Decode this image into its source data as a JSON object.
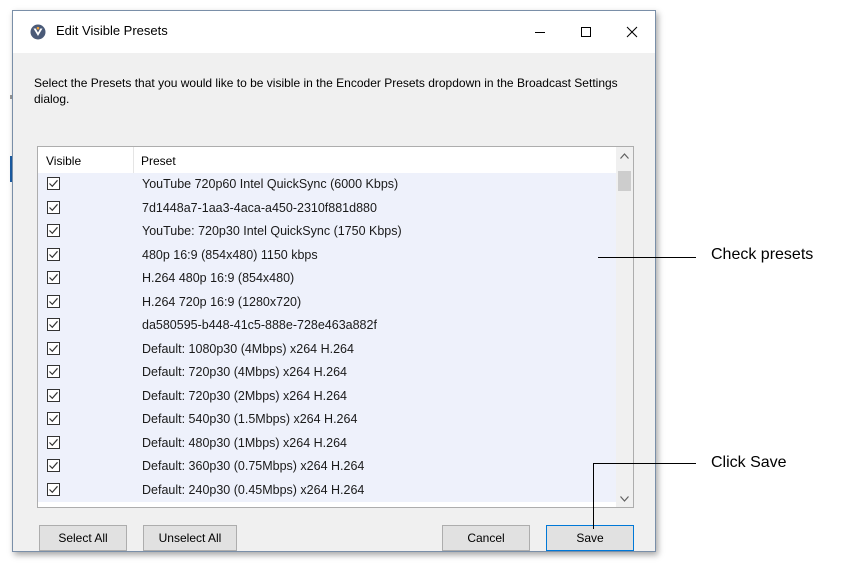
{
  "dialog": {
    "title": "Edit Visible Presets",
    "instructions": "Select the Presets that you would like to be visible in the Encoder Presets dropdown in the Broadcast Settings dialog."
  },
  "list": {
    "columns": {
      "visible": "Visible",
      "preset": "Preset"
    },
    "rows": [
      {
        "checked": true,
        "name": "YouTube 720p60 Intel QuickSync (6000 Kbps)"
      },
      {
        "checked": true,
        "name": "7d1448a7-1aa3-4aca-a450-2310f881d880"
      },
      {
        "checked": true,
        "name": "YouTube: 720p30 Intel QuickSync (1750 Kbps)"
      },
      {
        "checked": true,
        "name": "480p 16:9 (854x480) 1150 kbps"
      },
      {
        "checked": true,
        "name": "H.264 480p 16:9 (854x480)"
      },
      {
        "checked": true,
        "name": "H.264 720p 16:9 (1280x720)"
      },
      {
        "checked": true,
        "name": "da580595-b448-41c5-888e-728e463a882f"
      },
      {
        "checked": true,
        "name": "Default: 1080p30 (4Mbps) x264 H.264"
      },
      {
        "checked": true,
        "name": "Default: 720p30 (4Mbps) x264 H.264"
      },
      {
        "checked": true,
        "name": "Default: 720p30 (2Mbps) x264 H.264"
      },
      {
        "checked": true,
        "name": "Default: 540p30 (1.5Mbps) x264 H.264"
      },
      {
        "checked": true,
        "name": "Default: 480p30 (1Mbps) x264 H.264"
      },
      {
        "checked": true,
        "name": "Default: 360p30 (0.75Mbps) x264 H.264"
      },
      {
        "checked": true,
        "name": "Default: 240p30 (0.45Mbps) x264 H.264"
      }
    ]
  },
  "buttons": {
    "select_all": "Select All",
    "unselect_all": "Unselect All",
    "cancel": "Cancel",
    "save": "Save"
  },
  "annotations": {
    "check_presets": "Check presets",
    "click_save": "Click Save"
  },
  "colors": {
    "row_background": "#eef1fb",
    "save_border": "#0078d7"
  },
  "icons": {
    "app": "app-logo-icon",
    "minimize": "minimize-icon",
    "maximize": "maximize-icon",
    "close": "close-icon",
    "checkbox": "checkmark-icon",
    "scroll_up": "chevron-up-icon",
    "scroll_down": "chevron-down-icon"
  }
}
